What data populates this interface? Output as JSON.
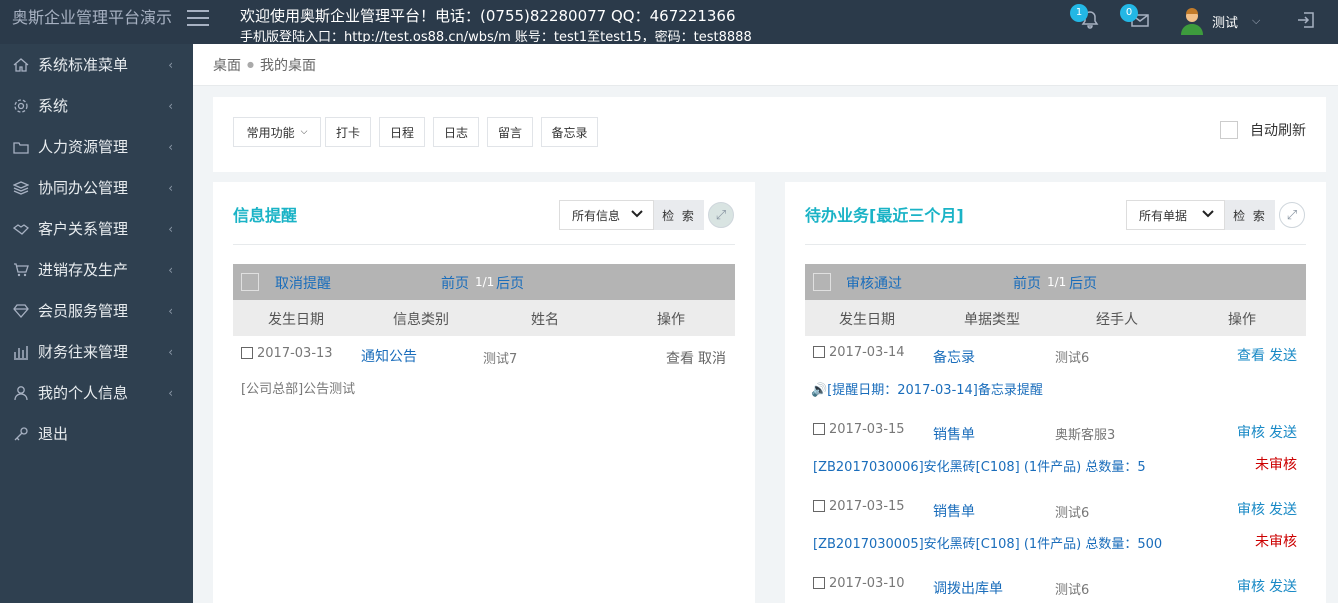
{
  "app": {
    "brand": "奥斯企业管理平台演示",
    "marquee_line1": "欢迎使用奥斯企业管理平台！电话：(0755)82280077 QQ：467221366",
    "marquee_line2": "手机版登陆入口：http://test.os88.cn/wbs/m 账号：test1至test15，密码：test8888"
  },
  "header": {
    "notifications_count": "1",
    "messages_count": "0",
    "user_name": "测试"
  },
  "sidebar": {
    "items": [
      {
        "label": "系统标准菜单",
        "icon": "home-icon"
      },
      {
        "label": "系统",
        "icon": "gear-icon"
      },
      {
        "label": "人力资源管理",
        "icon": "folder-icon"
      },
      {
        "label": "协同办公管理",
        "icon": "layers-icon"
      },
      {
        "label": "客户关系管理",
        "icon": "handshake-icon"
      },
      {
        "label": "进销存及生产",
        "icon": "cart-icon"
      },
      {
        "label": "会员服务管理",
        "icon": "diamond-icon"
      },
      {
        "label": "财务往来管理",
        "icon": "bar-chart-icon"
      },
      {
        "label": "我的个人信息",
        "icon": "user-icon"
      },
      {
        "label": "退出",
        "icon": "key-icon"
      }
    ]
  },
  "breadcrumb": {
    "root": "桌面",
    "current": "我的桌面"
  },
  "toolbar": {
    "common_functions": "常用功能",
    "buttons": [
      "打卡",
      "日程",
      "日志",
      "留言",
      "备忘录"
    ],
    "auto_refresh": "自动刷新"
  },
  "info_panel": {
    "title": "信息提醒",
    "filter": "所有信息",
    "search": "检 索",
    "cancel_reminder": "取消提醒",
    "prev": "前页",
    "page": "1/1",
    "next": "后页",
    "columns": [
      "发生日期",
      "信息类别",
      "姓名",
      "操作"
    ],
    "rows": [
      {
        "date": "2017-03-13",
        "type": "通知公告",
        "name": "测试7",
        "op_view": "查看",
        "op_cancel": "取消",
        "detail": "[公司总部]公告测试"
      }
    ]
  },
  "todo_panel": {
    "title": "待办业务[最近三个月]",
    "filter": "所有单据",
    "search": "检 索",
    "approve": "审核通过",
    "prev": "前页",
    "page": "1/1",
    "next": "后页",
    "columns": [
      "发生日期",
      "单据类型",
      "经手人",
      "操作"
    ],
    "rows": [
      {
        "date": "2017-03-14",
        "type": "备忘录",
        "name": "测试6",
        "op1": "查看",
        "op2": "发送",
        "detail": "🔊[提醒日期：2017-03-14]备忘录提醒",
        "status": ""
      },
      {
        "date": "2017-03-15",
        "type": "销售单",
        "name": "奥斯客服3",
        "op1": "审核",
        "op2": "发送",
        "detail": "[ZB2017030006]安化黑砖[C108] (1件产品) 总数量：5",
        "status": "未审核"
      },
      {
        "date": "2017-03-15",
        "type": "销售单",
        "name": "测试6",
        "op1": "审核",
        "op2": "发送",
        "detail": "[ZB2017030005]安化黑砖[C108] (1件产品) 总数量：500",
        "status": "未审核"
      },
      {
        "date": "2017-03-10",
        "type": "调拨出库单",
        "name": "测试6",
        "op1": "审核",
        "op2": "发送",
        "detail": "",
        "status": ""
      }
    ]
  }
}
